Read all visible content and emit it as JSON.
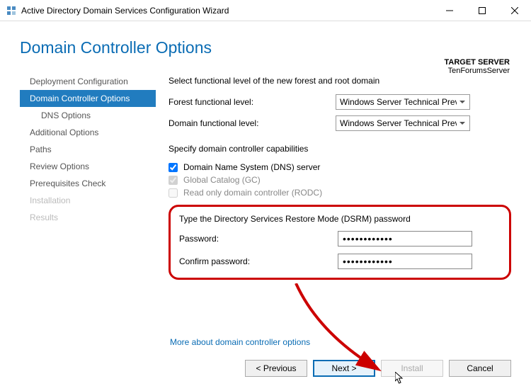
{
  "window": {
    "title": "Active Directory Domain Services Configuration Wizard"
  },
  "header": {
    "page_title": "Domain Controller Options",
    "target_server_label": "TARGET SERVER",
    "target_server_value": "TenForumsServer"
  },
  "sidebar": {
    "items": [
      {
        "label": "Deployment Configuration",
        "selected": false,
        "indent": false,
        "disabled": false
      },
      {
        "label": "Domain Controller Options",
        "selected": true,
        "indent": false,
        "disabled": false
      },
      {
        "label": "DNS Options",
        "selected": false,
        "indent": true,
        "disabled": false
      },
      {
        "label": "Additional Options",
        "selected": false,
        "indent": false,
        "disabled": false
      },
      {
        "label": "Paths",
        "selected": false,
        "indent": false,
        "disabled": false
      },
      {
        "label": "Review Options",
        "selected": false,
        "indent": false,
        "disabled": false
      },
      {
        "label": "Prerequisites Check",
        "selected": false,
        "indent": false,
        "disabled": false
      },
      {
        "label": "Installation",
        "selected": false,
        "indent": false,
        "disabled": true
      },
      {
        "label": "Results",
        "selected": false,
        "indent": false,
        "disabled": true
      }
    ]
  },
  "main": {
    "section1_text": "Select functional level of the new forest and root domain",
    "forest_label": "Forest functional level:",
    "forest_value": "Windows Server Technical Previe",
    "domain_label": "Domain functional level:",
    "domain_value": "Windows Server Technical Previe",
    "section2_text": "Specify domain controller capabilities",
    "chk1_label": "Domain Name System (DNS) server",
    "chk1_checked": true,
    "chk2_label": "Global Catalog (GC)",
    "chk2_checked": true,
    "chk2_disabled": true,
    "chk3_label": "Read only domain controller (RODC)",
    "chk3_checked": false,
    "chk3_disabled": true,
    "dsrm_heading": "Type the Directory Services Restore Mode (DSRM) password",
    "password_label": "Password:",
    "password_value": "••••••••••••",
    "confirm_label": "Confirm password:",
    "confirm_value": "••••••••••••",
    "more_link": "More about domain controller options"
  },
  "footer": {
    "previous": "< Previous",
    "next": "Next >",
    "install": "Install",
    "cancel": "Cancel"
  }
}
